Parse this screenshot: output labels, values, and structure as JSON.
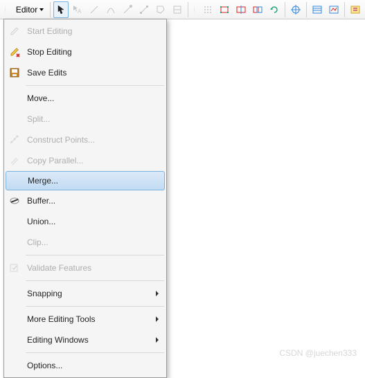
{
  "toolbar": {
    "editor_label": "Editor"
  },
  "menu": {
    "start_editing": "Start Editing",
    "stop_editing": "Stop Editing",
    "save_edits": "Save Edits",
    "move": "Move...",
    "split": "Split...",
    "construct_points": "Construct Points...",
    "copy_parallel": "Copy Parallel...",
    "merge": "Merge...",
    "buffer": "Buffer...",
    "union": "Union...",
    "clip": "Clip...",
    "validate_features": "Validate Features",
    "snapping": "Snapping",
    "more_editing_tools": "More Editing Tools",
    "editing_windows": "Editing Windows",
    "options": "Options..."
  },
  "watermark": "CSDN @juechen333"
}
